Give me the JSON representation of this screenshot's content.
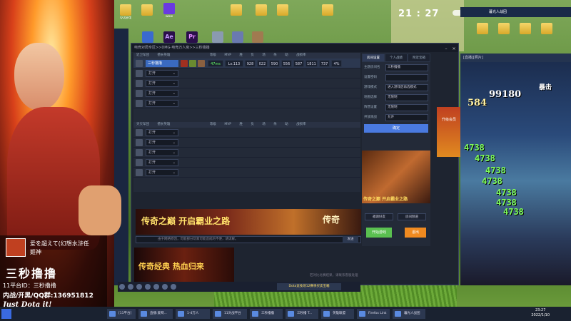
{
  "streamer": {
    "chat_user": "爱を超えて(幻想水浒任",
    "chat_user_line2": "姬神",
    "title": "三秒撸撸",
    "platform_id": "11平台ID：三秒撸撸",
    "qq_group": "内战/开黑/QQ群:136951812",
    "slogan": "Just Dota it!"
  },
  "desktop": {
    "clock": "21 : 27",
    "icons": [
      {
        "label": "QQ游戏",
        "kind": "folder"
      },
      {
        "label": "wow",
        "kind": "media"
      },
      {
        "label": "Ae",
        "kind": "ae"
      },
      {
        "label": "Pr",
        "kind": "pr"
      },
      {
        "label": "",
        "kind": "folder"
      },
      {
        "label": "",
        "kind": "folder"
      },
      {
        "label": "",
        "kind": "folder"
      },
      {
        "label": "",
        "kind": "folder"
      }
    ]
  },
  "main_window": {
    "breadcrumb": "电竞对局专区>>DMG-电竞万人房>>三秒撸撸",
    "team1_header": [
      "近卫军团",
      "擅长英雄",
      "等级",
      "MVP",
      "胜",
      "负",
      "场",
      "杀",
      "助",
      "战损率"
    ],
    "team2_header": [
      "天灾军团",
      "擅长英雄",
      "等级",
      "MVP",
      "胜",
      "负",
      "场",
      "杀",
      "助",
      "战损率"
    ],
    "player": {
      "name": "三秒撸撸",
      "ping": "47ms",
      "level": "Lv.113",
      "stats": [
        "928",
        "022",
        "590",
        "556",
        "587",
        "1811",
        "737",
        "4%"
      ]
    },
    "slot_label": "打开",
    "chat_placeholder": "由于网络原因，可能部分玩家可能造成的不便，请谅解。",
    "send_label": "发送",
    "footer_note": "若对比比赛结果，请联系客服处理"
  },
  "right_panel": {
    "tabs": [
      "房间设置",
      "个人战绩",
      "附近宝箱"
    ],
    "fields": [
      {
        "label": "主题房间名",
        "value": "三秒撸撸"
      },
      {
        "label": "设置密码",
        "value": ""
      },
      {
        "label": "游戏模式",
        "value": "进入游戏后再选模式"
      },
      {
        "label": "地图选择",
        "value": "无限制"
      },
      {
        "label": "阵营设置",
        "value": "无限制"
      },
      {
        "label": "开放观战",
        "value": "允许"
      }
    ],
    "confirm_label": "确定",
    "ad_text": "传奇之巅 开启霸业之路",
    "invite_label": "邀请好友",
    "room_label": "房间频道",
    "start_label": "开始游戏",
    "exit_label": "退出"
  },
  "banner": {
    "text": "传奇之巅  开启霸业之路",
    "side": "传奇"
  },
  "ad2": {
    "text": "传奇经典 热血归来"
  },
  "game": {
    "title": "暮光人战团",
    "bar": "[直播][照片]",
    "damage_numbers": [
      "4738",
      "4738",
      "4738",
      "4738",
      "4738",
      "4738",
      "4738"
    ],
    "combo": "99180",
    "combo2": "584",
    "tag": "暴击",
    "side_tag": "升级会员"
  },
  "tray": {
    "notice": "Dota竞技场12赛季买卖宝箱"
  },
  "taskbar": {
    "items": [
      "[11平台]",
      "直播:爱网...",
      "1-4万人",
      "11对战平台",
      "三秒撸撸",
      "三秒撸 T...",
      "英雄联盟",
      "Firefox Link",
      "暮光人战团"
    ],
    "time": "23:27",
    "date": "2022/1/10"
  }
}
